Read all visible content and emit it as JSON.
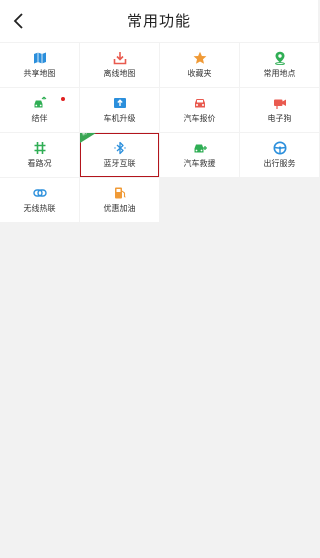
{
  "header": {
    "title": "常用功能",
    "back_icon": "chevron-left-icon"
  },
  "colors": {
    "blue": "#2b8fdc",
    "red": "#e95a4f",
    "orange": "#f09a36",
    "green": "#2fae54",
    "selection_border": "#b3151c",
    "badge_green": "#3aa654"
  },
  "grid": {
    "items": [
      {
        "label": "共享地图",
        "icon": "map-icon"
      },
      {
        "label": "离线地图",
        "icon": "download-icon"
      },
      {
        "label": "收藏夹",
        "icon": "star-icon"
      },
      {
        "label": "常用地点",
        "icon": "location-pin-icon"
      },
      {
        "label": "结伴",
        "icon": "car-group-icon"
      },
      {
        "label": "车机升级",
        "icon": "upload-icon"
      },
      {
        "label": "汽车报价",
        "icon": "car-price-icon"
      },
      {
        "label": "电子狗",
        "icon": "camera-icon"
      },
      {
        "label": "看路况",
        "icon": "traffic-icon"
      },
      {
        "label": "蓝牙互联",
        "icon": "bluetooth-icon",
        "badge": "新"
      },
      {
        "label": "汽车救援",
        "icon": "car-rescue-icon"
      },
      {
        "label": "出行服务",
        "icon": "steering-wheel-icon"
      },
      {
        "label": "无线热联",
        "icon": "wireless-link-icon"
      },
      {
        "label": "优惠加油",
        "icon": "fuel-pump-icon"
      }
    ]
  }
}
